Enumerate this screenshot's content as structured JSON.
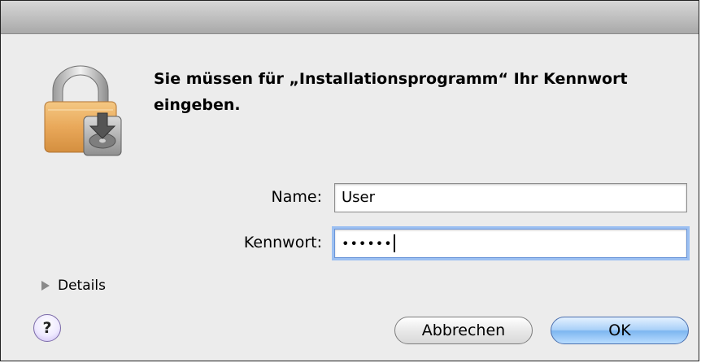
{
  "dialog": {
    "message": "Sie müssen für „Installationsprogramm“ Ihr Kennwort eingeben.",
    "name_label": "Name:",
    "name_value": "User",
    "password_label": "Kennwort:",
    "password_mask": "••••••",
    "details_label": "Details",
    "help_label": "?",
    "cancel_label": "Abbrechen",
    "ok_label": "OK"
  },
  "icons": [
    "lock-icon",
    "disclosure-triangle-icon",
    "help-icon"
  ],
  "colors": {
    "focus_ring": "#9cc0f2",
    "default_button": "#7db6f0"
  }
}
